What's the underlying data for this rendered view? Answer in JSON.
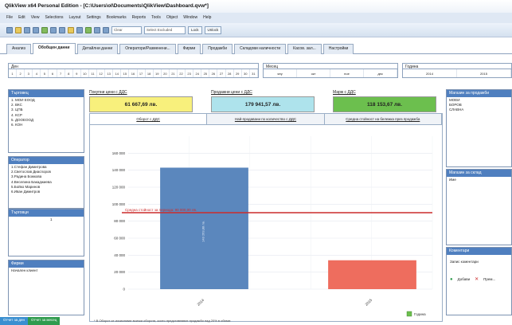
{
  "window": {
    "title": "QlikView x64 Personal Edition - [C:\\Users\\ol\\Documents\\QlikView\\Dashboard.qvw*]"
  },
  "menu": [
    "File",
    "Edit",
    "View",
    "Selections",
    "Layout",
    "Settings",
    "Bookmarks",
    "Reports",
    "Tools",
    "Object",
    "Window",
    "Help"
  ],
  "toolbar": {
    "combo1": "Clear",
    "combo2": "Select Excluded",
    "btn1": "Lock",
    "btn2": "Unlock"
  },
  "tabs": [
    "Анализ",
    "Обобщен данни",
    "Детайлни данни",
    "Оператори/Разменени...",
    "Фирми",
    "Продажби",
    "Складови наличности",
    "Касов. зал...",
    "Настройки"
  ],
  "day_filter": {
    "label": "Ден",
    "values": [
      "1",
      "2",
      "3",
      "4",
      "5",
      "6",
      "7",
      "8",
      "9",
      "10",
      "11",
      "12",
      "13",
      "14",
      "15",
      "16",
      "17",
      "18",
      "19",
      "20",
      "21",
      "22",
      "23",
      "24",
      "25",
      "26",
      "27",
      "28",
      "29",
      "30",
      "31"
    ]
  },
  "month_filter": {
    "label": "Месец",
    "values": [
      "яну",
      "окт",
      "ное",
      "дек"
    ]
  },
  "year_filter": {
    "label": "Година",
    "values": [
      "2014",
      "2015"
    ]
  },
  "left_panels": {
    "stores": {
      "title": "Търговец",
      "items": [
        "1. МОИ ЕООД",
        "2. ВКС",
        "3. ЦПБ",
        "4. КСР",
        "5. ДООЕООД",
        "6. КОН"
      ]
    },
    "operators": {
      "title": "Оператор",
      "items": [
        "1.Стефан Димитрова",
        "2.Светослав Диаспоров",
        "3.Радина Божкова",
        "4.Веселина Бакаджиева",
        "5.Бойко Маринов",
        "6.Иван Димитров"
      ]
    },
    "traders": {
      "title": "Търговци",
      "items": [
        "1"
      ]
    },
    "firms": {
      "title": "Фирми",
      "items": [
        "Начален клиент"
      ]
    }
  },
  "kpis": [
    {
      "label": "Покупни цени с ДДС",
      "value": "61 667,69 лв.",
      "color": "#f8f07c"
    },
    {
      "label": "Продажни цени с ДДС",
      "value": "179 941,57 лв.",
      "color": "#aee3ec"
    },
    {
      "label": "Марж с ДДС",
      "value": "118 153,67 лв.",
      "color": "#6cbf4e"
    }
  ],
  "chart_tabs": [
    "Оборот с ДДС",
    "Най-продавани по количество с ДДС",
    "Средна стойност на бележка през продажба"
  ],
  "chart_data": {
    "type": "bar",
    "categories": [
      "2014",
      "2015"
    ],
    "values": [
      143000,
      34000
    ],
    "colors": [
      "#5b87bd",
      "#ee6d5e"
    ],
    "ylim": [
      0,
      180000
    ],
    "y_ticks": [
      "0",
      "20 000",
      "40 000",
      "60 000",
      "80 000",
      "100 000",
      "120 000",
      "140 000",
      "160 000"
    ],
    "reference_line": {
      "value": 90000,
      "label": "Средна стойност за периода: 90 000,00 лв.",
      "color": "#cc2b2b"
    },
    "bar_label": "143 263,88 лв.",
    "legend": "Година"
  },
  "right_panels": {
    "top": {
      "title": "Магазин за продажби",
      "items": [
        "МОЕИ",
        "БОРОВ",
        "СЛАВНА"
      ]
    },
    "mid": {
      "title": "Магазин за склад",
      "items": [
        "Име"
      ]
    },
    "bottom": {
      "title": "Коментари",
      "label": "Запис коментари",
      "add": "Добави",
      "remove": "Прем..."
    }
  },
  "footer": {
    "note": "* В Оборот се изчисляват всички обороти, които представляват продажби над 20% в обхват.",
    "buttons": [
      "Отчет за ден",
      "Отчет за месец"
    ]
  }
}
